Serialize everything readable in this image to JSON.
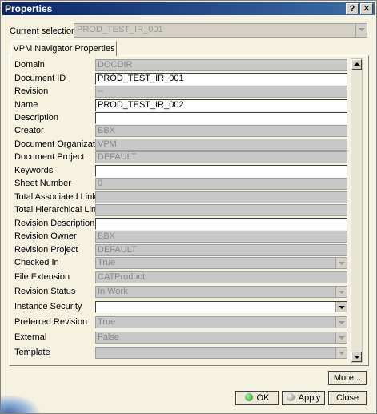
{
  "window": {
    "title": "Properties",
    "help_glyph": "?",
    "close_glyph": "✕"
  },
  "current_selection": {
    "label": "Current selection :",
    "value": "PROD_TEST_IR_001"
  },
  "tab": {
    "label": "VPM Navigator Properties"
  },
  "fields": {
    "domain": {
      "label": "Domain",
      "value": "DOCDIR"
    },
    "document_id": {
      "label": "Document ID",
      "value": "PROD_TEST_IR_001"
    },
    "revision": {
      "label": "Revision",
      "value": "--"
    },
    "name": {
      "label": "Name",
      "value": "PROD_TEST_IR_002"
    },
    "description": {
      "label": "Description",
      "value": ""
    },
    "creator": {
      "label": "Creator",
      "value": "BBX"
    },
    "document_organization": {
      "label": "Document Organization",
      "value": "VPM"
    },
    "document_project": {
      "label": "Document Project",
      "value": "DEFAULT"
    },
    "keywords": {
      "label": "Keywords",
      "value": ""
    },
    "sheet_number": {
      "label": "Sheet Number",
      "value": "0"
    },
    "total_associated_links": {
      "label": "Total Associated Links",
      "value": ""
    },
    "total_hierarchical_links": {
      "label": "Total Hierarchical Links",
      "value": ""
    },
    "revision_description": {
      "label": "Revision Description",
      "value": ""
    },
    "revision_owner": {
      "label": "Revision Owner",
      "value": "BBX"
    },
    "revision_project": {
      "label": "Revision Project",
      "value": "DEFAULT"
    },
    "checked_in": {
      "label": "Checked In",
      "value": "True"
    },
    "file_extension": {
      "label": "File Extension",
      "value": "CATProduct"
    },
    "revision_status": {
      "label": "Revision Status",
      "value": "In Work"
    },
    "instance_security": {
      "label": "Instance Security",
      "value": ""
    },
    "preferred_revision": {
      "label": "Preferred Revision",
      "value": "True"
    },
    "external": {
      "label": "External",
      "value": "False"
    },
    "template": {
      "label": "Template",
      "value": ""
    }
  },
  "buttons": {
    "more": "More...",
    "ok": "OK",
    "apply": "Apply",
    "close": "Close"
  }
}
